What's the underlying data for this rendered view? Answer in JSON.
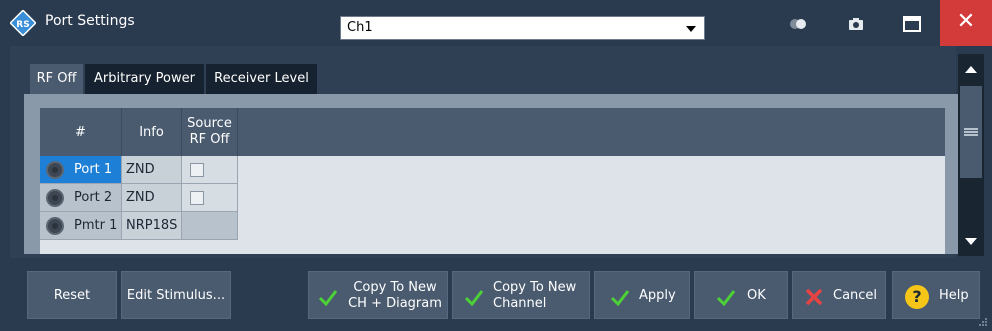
{
  "window": {
    "title": "Port Settings",
    "channel": "Ch1"
  },
  "tabs": [
    {
      "label": "RF Off",
      "active": true
    },
    {
      "label": "Arbitrary Power",
      "active": false
    },
    {
      "label": "Receiver Level",
      "active": false
    }
  ],
  "table": {
    "headers": [
      "#",
      "Info",
      "Source RF Off"
    ],
    "rows": [
      {
        "port": "Port 1",
        "info": "ZND",
        "source_rf_off": false,
        "selected": true
      },
      {
        "port": "Port 2",
        "info": "ZND",
        "source_rf_off": false,
        "selected": false
      },
      {
        "port": "Pmtr 1",
        "info": "NRP18S",
        "source_rf_off": null,
        "selected": false
      }
    ]
  },
  "buttons": {
    "reset": "Reset",
    "edit_stimulus": "Edit Stimulus...",
    "copy_ch_diagram": "Copy To New CH + Diagram",
    "copy_channel": "Copy To New Channel",
    "apply": "Apply",
    "ok": "OK",
    "cancel": "Cancel",
    "help": "Help"
  },
  "colors": {
    "title_bg": "#2a3a4f",
    "close": "#d33b3b",
    "selection": "#1e7fd6",
    "check": "#4cd137",
    "cancel_x": "#e84343",
    "help": "#f5c518"
  },
  "icons": [
    "app-logo-icon",
    "toggle-icon",
    "camera-icon",
    "maximize-icon",
    "close-icon",
    "check-icon",
    "cancel-icon",
    "help-icon",
    "port-icon"
  ]
}
